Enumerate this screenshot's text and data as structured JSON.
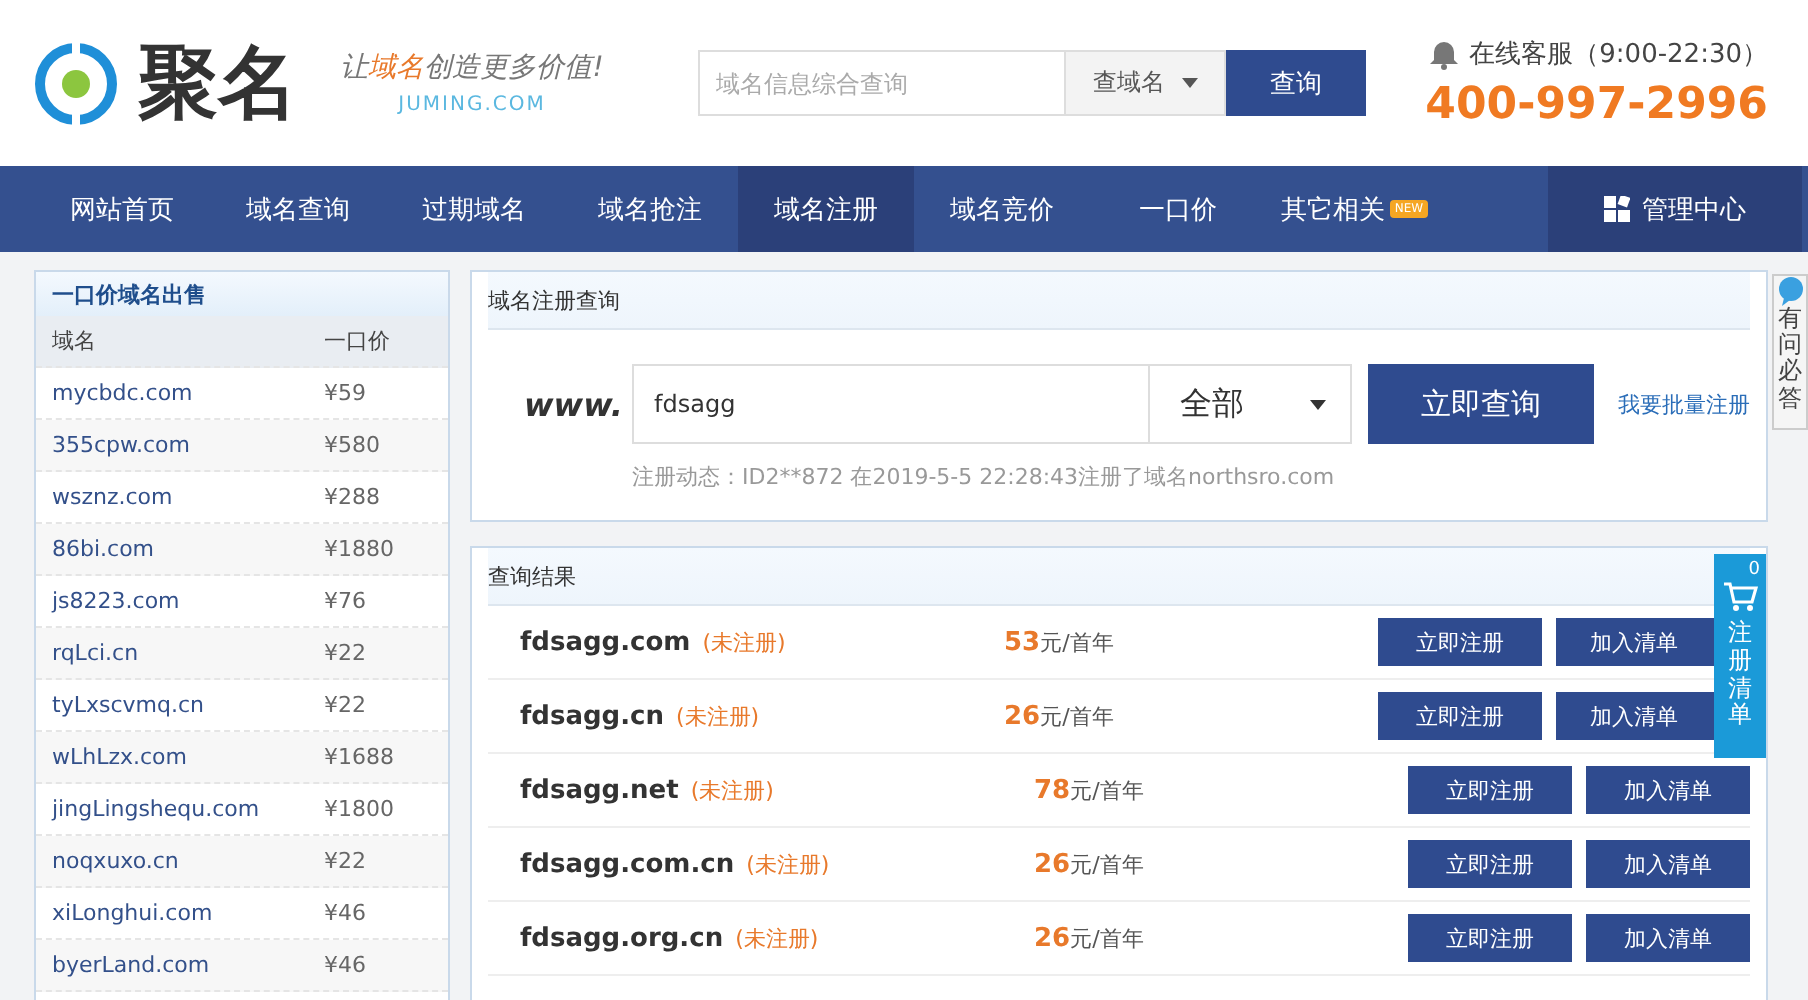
{
  "header": {
    "brand": "聚名",
    "slogan": [
      {
        "text": "让",
        "accent": false
      },
      {
        "text": "域名",
        "accent": true
      },
      {
        "text": "创造更多价值!",
        "accent": false
      }
    ],
    "domain": "JUMING.COM",
    "search": {
      "placeholder": "域名信息综合查询",
      "scope": "查域名",
      "button": "查询"
    },
    "service": "在线客服（9:00-22:30）",
    "phone": "400-997-2996"
  },
  "nav": [
    {
      "label": "网站首页",
      "selected": false
    },
    {
      "label": "域名查询",
      "selected": false
    },
    {
      "label": "过期域名",
      "selected": false
    },
    {
      "label": "域名抢注",
      "selected": false
    },
    {
      "label": "域名注册",
      "selected": true
    },
    {
      "label": "域名竞价",
      "selected": false
    },
    {
      "label": "一口价",
      "selected": false
    },
    {
      "label": "其它相关",
      "selected": false,
      "badge": "NEW"
    }
  ],
  "admin": "管理中心",
  "sale": {
    "title": "一口价域名出售",
    "columns": [
      "域名",
      "一口价"
    ],
    "rows": [
      {
        "domain": "mycbdc.com",
        "price": "¥59"
      },
      {
        "domain": "355cpw.com",
        "price": "¥580"
      },
      {
        "domain": "wsznz.com",
        "price": "¥288"
      },
      {
        "domain": "86bi.com",
        "price": "¥1880"
      },
      {
        "domain": "js8223.com",
        "price": "¥76"
      },
      {
        "domain": "rqLci.cn",
        "price": "¥22"
      },
      {
        "domain": "tyLxscvmq.cn",
        "price": "¥22"
      },
      {
        "domain": "wLhLzx.com",
        "price": "¥1688"
      },
      {
        "domain": "jingLingshequ.com",
        "price": "¥1800"
      },
      {
        "domain": "noqxuxo.cn",
        "price": "¥22"
      },
      {
        "domain": "xiLonghui.com",
        "price": "¥46"
      },
      {
        "domain": "byerLand.com",
        "price": "¥46"
      }
    ]
  },
  "register": {
    "title": "域名注册查询",
    "prefix": "www.",
    "value": "fdsagg",
    "suffix": "全部",
    "button": "立即查询",
    "bulk_link": "我要批量注册",
    "activity": "注册动态：ID2**872 在2019-5-5 22:28:43注册了域名northsro.com"
  },
  "results": {
    "title": "查询结果",
    "rows": [
      {
        "domain": "fdsagg.com",
        "status": "(未注册)",
        "price": "53",
        "unit": "元/首年",
        "register": "立即注册",
        "add": "加入清单"
      },
      {
        "domain": "fdsagg.cn",
        "status": "(未注册)",
        "price": "26",
        "unit": "元/首年",
        "register": "立即注册",
        "add": "加入清单"
      },
      {
        "domain": "fdsagg.net",
        "status": "(未注册)",
        "price": "78",
        "unit": "元/首年",
        "register": "立即注册",
        "add": "加入清单"
      },
      {
        "domain": "fdsagg.com.cn",
        "status": "(未注册)",
        "price": "26",
        "unit": "元/首年",
        "register": "立即注册",
        "add": "加入清单"
      },
      {
        "domain": "fdsagg.org.cn",
        "status": "(未注册)",
        "price": "26",
        "unit": "元/首年",
        "register": "立即注册",
        "add": "加入清单"
      }
    ]
  },
  "help_tab": "有问必答",
  "cart": {
    "count": "0",
    "label": "注册清单"
  }
}
